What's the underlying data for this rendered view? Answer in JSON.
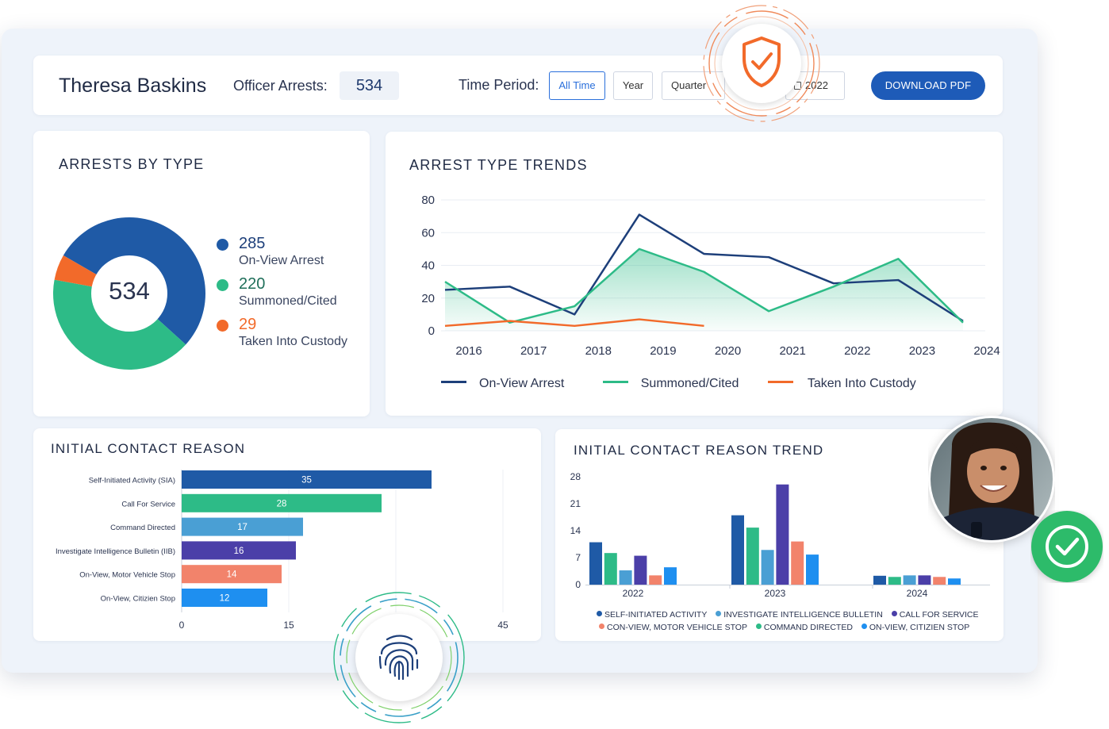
{
  "header": {
    "officer_name": "Theresa Baskins",
    "arrests_label": "Officer Arrests:",
    "arrests_value": "534",
    "period_label": "Time Period:",
    "period_buttons": [
      "All Time",
      "Year",
      "Quarter"
    ],
    "date_value": "2022",
    "download_label": "DOWNLOAD PDF"
  },
  "arrests_by_type": {
    "title": "ARRESTS BY TYPE",
    "total": "534",
    "items": [
      {
        "value": "285",
        "label": "On-View Arrest",
        "color": "#1f5aa6"
      },
      {
        "value": "220",
        "label": "Summoned/Cited",
        "color": "#2dbb87"
      },
      {
        "value": "29",
        "label": "Taken Into Custody",
        "color": "#f26a2a"
      }
    ]
  },
  "trend_legend": [
    "On-View Arrest",
    "Summoned/Cited",
    "Taken Into Custody"
  ],
  "contact_reason": {
    "title": "INITIAL CONTACT REASON"
  },
  "contact_trend": {
    "title": "INITIAL CONTACT REASON TREND",
    "legend": [
      "SELF-INITIATED ACTIVITY",
      "INVESTIGATE INTELLIGENCE BULLETIN",
      "CALL FOR SERVICE",
      "CON-VIEW, MOTOR VEHICLE STOP",
      "COMMAND DIRECTED",
      "ON-VIEW, CITIZIEN STOP"
    ]
  },
  "icons": [
    "shield-check-icon",
    "fingerprint-icon",
    "check-circle-icon",
    "officer-avatar"
  ],
  "chart_data": [
    {
      "type": "pie",
      "title": "ARRESTS BY TYPE",
      "categories": [
        "On-View Arrest",
        "Summoned/Cited",
        "Taken Into Custody"
      ],
      "values": [
        285,
        220,
        29
      ],
      "colors": [
        "#1f5aa6",
        "#2dbb87",
        "#f26a2a"
      ]
    },
    {
      "type": "line",
      "title": "ARREST TYPE TRENDS",
      "x": [
        2016,
        2017,
        2018,
        2019,
        2020,
        2021,
        2022,
        2023,
        2024
      ],
      "ylim": [
        0,
        80
      ],
      "yticks": [
        0,
        20,
        40,
        60,
        80
      ],
      "series": [
        {
          "name": "On-View Arrest",
          "color": "#1d3f7a",
          "values": [
            25,
            27,
            10,
            71,
            47,
            45,
            29,
            31,
            6
          ]
        },
        {
          "name": "Summoned/Cited",
          "color": "#2dbb87",
          "values": [
            30,
            5,
            15,
            50,
            36,
            12,
            27,
            44,
            5
          ]
        },
        {
          "name": "Taken Into Custody",
          "color": "#f26a2a",
          "values": [
            3,
            6,
            3,
            7,
            3,
            null,
            null,
            null,
            null
          ]
        }
      ]
    },
    {
      "type": "bar",
      "title": "INITIAL CONTACT REASON",
      "categories": [
        "Self-Initiated Activity (SIA)",
        "Call For Service",
        "Command Directed",
        "Investigate Intelligence Bulletin (IIB)",
        "On-View, Motor Vehicle Stop",
        "On-View, Citizien Stop"
      ],
      "values": [
        35,
        28,
        17,
        16,
        14,
        12
      ],
      "colors": [
        "#1f5aa6",
        "#2dbb87",
        "#4a9fd4",
        "#4b3fa8",
        "#f2836b",
        "#1e8ff0"
      ],
      "xticks": [
        0,
        15,
        45
      ],
      "xlim": [
        0,
        47
      ]
    },
    {
      "type": "bar",
      "title": "INITIAL CONTACT REASON TREND",
      "categories": [
        "2022",
        "2023",
        "2024"
      ],
      "ylim": [
        0,
        28
      ],
      "yticks": [
        0,
        7,
        14,
        21,
        28
      ],
      "series": [
        {
          "color": "#1f5aa6",
          "values": [
            11,
            18,
            2.3
          ]
        },
        {
          "color": "#2dbb87",
          "values": [
            8.2,
            14.8,
            2
          ]
        },
        {
          "color": "#4a9fd4",
          "values": [
            3.7,
            9,
            2.4
          ]
        },
        {
          "color": "#4b3fa8",
          "values": [
            7.5,
            26,
            2.4
          ]
        },
        {
          "color": "#f2836b",
          "values": [
            2.4,
            11.2,
            2
          ]
        },
        {
          "color": "#1e8ff0",
          "values": [
            4.5,
            7.8,
            1.6
          ]
        }
      ]
    }
  ]
}
